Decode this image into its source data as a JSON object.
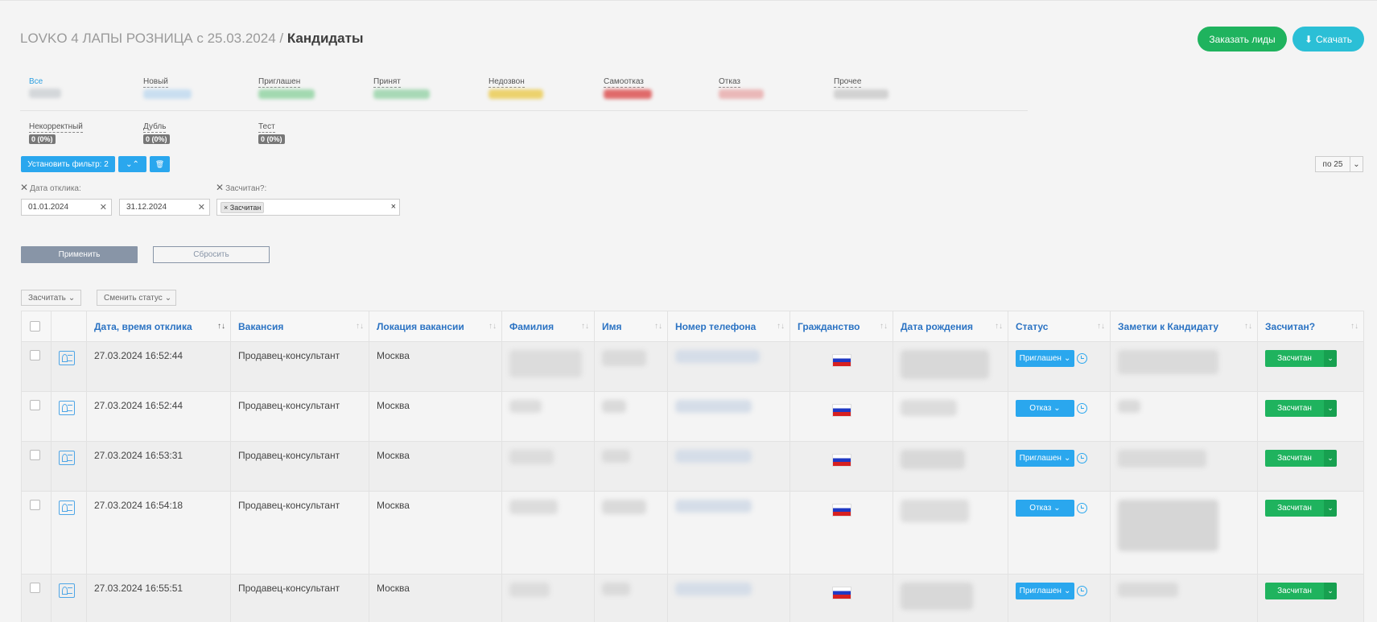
{
  "header": {
    "title_prefix": "LOVKO 4 ЛАПЫ РОЗНИЦА c 25.03.2024 / ",
    "title_main": "Кандидаты",
    "order_leads": "Заказать лиды",
    "download": "Скачать",
    "download_icon": "download-icon"
  },
  "stats": [
    {
      "label": "Все",
      "color": "#cfd4d8"
    },
    {
      "label": "Новый",
      "color": "#c6def2"
    },
    {
      "label": "Приглашен",
      "color": "#9fd8ad"
    },
    {
      "label": "Принят",
      "color": "#a6d9b5"
    },
    {
      "label": "Недозвон",
      "color": "#ecd36b"
    },
    {
      "label": "Самоотказ",
      "color": "#e06a6a"
    },
    {
      "label": "Отказ",
      "color": "#eab7b7"
    },
    {
      "label": "Прочее",
      "color": "#cfcfcf"
    }
  ],
  "stats2": [
    {
      "label": "Некорректный",
      "badge": "0 (0%)"
    },
    {
      "label": "Дубль",
      "badge": "0 (0%)"
    },
    {
      "label": "Тест",
      "badge": "0 (0%)"
    }
  ],
  "filters": {
    "set_filter": "Установить фильтр: 2",
    "per_page": "по 25",
    "date_label": "Дата отклика:",
    "date_from": "01.01.2024",
    "date_to": "31.12.2024",
    "counted_label": "Засчитан?:",
    "counted_tag": "Засчитан",
    "apply": "Применить",
    "reset": "Сбросить"
  },
  "bulk": {
    "count": "Засчитать",
    "change_status": "Сменить статус"
  },
  "table": {
    "columns": [
      "Дата, время отклика",
      "Вакансия",
      "Локация вакансии",
      "Фамилия",
      "Имя",
      "Номер телефона",
      "Гражданство",
      "Дата рождения",
      "Статус",
      "Заметки к Кандидату",
      "Засчитан?"
    ],
    "rows": [
      {
        "datetime": "27.03.2024 16:52:44",
        "vacancy": "Продавец-консультант",
        "location": "Москва",
        "status": "Приглашен",
        "counted": "Засчитан"
      },
      {
        "datetime": "27.03.2024 16:52:44",
        "vacancy": "Продавец-консультант",
        "location": "Москва",
        "status": "Отказ",
        "counted": "Засчитан"
      },
      {
        "datetime": "27.03.2024 16:53:31",
        "vacancy": "Продавец-консультант",
        "location": "Москва",
        "status": "Приглашен",
        "counted": "Засчитан"
      },
      {
        "datetime": "27.03.2024 16:54:18",
        "vacancy": "Продавец-консультант",
        "location": "Москва",
        "status": "Отказ",
        "counted": "Засчитан"
      },
      {
        "datetime": "27.03.2024 16:55:51",
        "vacancy": "Продавец-консультант",
        "location": "Москва",
        "status": "Приглашен",
        "counted": "Засчитан"
      }
    ]
  },
  "colors": {
    "accent": "#2aa7ee",
    "green": "#1fb35e",
    "cyan": "#2bbfd6",
    "header_link": "#2b73c3"
  }
}
